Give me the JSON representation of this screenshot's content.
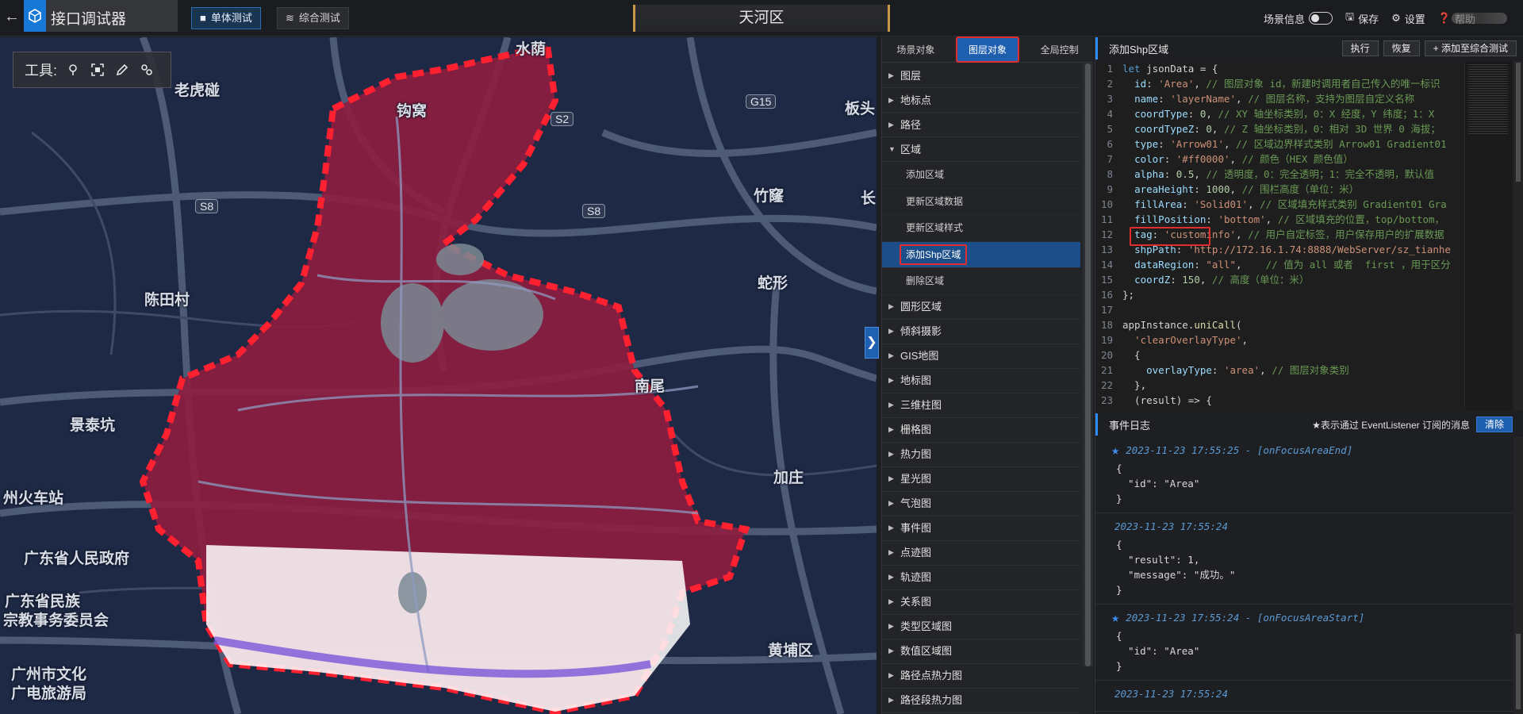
{
  "app": {
    "title": "接口调试器"
  },
  "mode_tabs": [
    {
      "label": "单体测试",
      "active": true
    },
    {
      "label": "综合测试",
      "active": false
    }
  ],
  "region_title": "天河区",
  "top_right": {
    "scene_info": "场景信息",
    "save": "保存",
    "settings": "设置",
    "help": "帮助"
  },
  "map": {
    "toolbar_label": "工具:",
    "labels": [
      {
        "text": "水荫"
      },
      {
        "text": "老虎碰"
      },
      {
        "text": "钩窝"
      },
      {
        "text": "板头"
      },
      {
        "text": "竹窿"
      },
      {
        "text": "长"
      },
      {
        "text": "陈田村"
      },
      {
        "text": "蛇形"
      },
      {
        "text": "南尾"
      },
      {
        "text": "景泰坑"
      },
      {
        "text": "加庄"
      },
      {
        "text": "州火车站"
      },
      {
        "text": "广东省人民政府"
      },
      {
        "text": "广东省民族"
      },
      {
        "text": "宗教事务委员会"
      },
      {
        "text": "广州市文化"
      },
      {
        "text": "广电旅游局"
      },
      {
        "text": "黄埔区"
      }
    ],
    "road_badges": [
      {
        "text": "G15"
      },
      {
        "text": "S2"
      },
      {
        "text": "S8"
      },
      {
        "text": "S8"
      }
    ],
    "overlay_color": "#ff0000",
    "overlay_alpha": 0.5
  },
  "mid_panel": {
    "tabs": [
      {
        "label": "场景对象",
        "active": false
      },
      {
        "label": "图层对象",
        "active": true
      },
      {
        "label": "全局控制",
        "active": false
      }
    ],
    "tree": [
      {
        "label": "图层",
        "expanded": false
      },
      {
        "label": "地标点",
        "expanded": false
      },
      {
        "label": "路径",
        "expanded": false
      },
      {
        "label": "区域",
        "expanded": true,
        "children": [
          {
            "label": "添加区域",
            "selected": false
          },
          {
            "label": "更新区域数据",
            "selected": false
          },
          {
            "label": "更新区域样式",
            "selected": false
          },
          {
            "label": "添加Shp区域",
            "selected": true
          },
          {
            "label": "删除区域",
            "selected": false
          }
        ]
      },
      {
        "label": "圆形区域",
        "expanded": false
      },
      {
        "label": "倾斜摄影",
        "expanded": false
      },
      {
        "label": "GIS地图",
        "expanded": false
      },
      {
        "label": "地标图",
        "expanded": false
      },
      {
        "label": "三维柱图",
        "expanded": false
      },
      {
        "label": "栅格图",
        "expanded": false
      },
      {
        "label": "热力图",
        "expanded": false
      },
      {
        "label": "星光图",
        "expanded": false
      },
      {
        "label": "气泡图",
        "expanded": false
      },
      {
        "label": "事件图",
        "expanded": false
      },
      {
        "label": "点迹图",
        "expanded": false
      },
      {
        "label": "轨迹图",
        "expanded": false
      },
      {
        "label": "关系图",
        "expanded": false
      },
      {
        "label": "类型区域图",
        "expanded": false
      },
      {
        "label": "数值区域图",
        "expanded": false
      },
      {
        "label": "路径点热力图",
        "expanded": false
      },
      {
        "label": "路径段热力图",
        "expanded": false
      }
    ]
  },
  "code_panel": {
    "title": "添加Shp区域",
    "buttons": {
      "run": "执行",
      "restore": "恢复",
      "add_to_combined": "添加至综合测试"
    },
    "lines": [
      [
        {
          "t": "kw",
          "v": "let "
        },
        {
          "t": "",
          "v": "jsonData = {"
        }
      ],
      [
        {
          "t": "",
          "v": "  "
        },
        {
          "t": "prop",
          "v": "id"
        },
        {
          "t": "",
          "v": ": "
        },
        {
          "t": "str",
          "v": "'Area'"
        },
        {
          "t": "",
          "v": ", "
        },
        {
          "t": "cmt",
          "v": "// 图层对象 id，新建时调用者自己传入的唯一标识"
        }
      ],
      [
        {
          "t": "",
          "v": "  "
        },
        {
          "t": "prop",
          "v": "name"
        },
        {
          "t": "",
          "v": ": "
        },
        {
          "t": "str",
          "v": "'layerName'"
        },
        {
          "t": "",
          "v": ", "
        },
        {
          "t": "cmt",
          "v": "// 图层名称，支持为图层自定义名称"
        }
      ],
      [
        {
          "t": "",
          "v": "  "
        },
        {
          "t": "prop",
          "v": "coordType"
        },
        {
          "t": "",
          "v": ": "
        },
        {
          "t": "num",
          "v": "0"
        },
        {
          "t": "",
          "v": ", "
        },
        {
          "t": "cmt",
          "v": "// XY 轴坐标类别，0：X 经度，Y 纬度；1：X"
        }
      ],
      [
        {
          "t": "",
          "v": "  "
        },
        {
          "t": "prop",
          "v": "coordTypeZ"
        },
        {
          "t": "",
          "v": ": "
        },
        {
          "t": "num",
          "v": "0"
        },
        {
          "t": "",
          "v": ", "
        },
        {
          "t": "cmt",
          "v": "// Z 轴坐标类别，0：相对 3D 世界 0 海拔；"
        }
      ],
      [
        {
          "t": "",
          "v": "  "
        },
        {
          "t": "prop",
          "v": "type"
        },
        {
          "t": "",
          "v": ": "
        },
        {
          "t": "str",
          "v": "'Arrow01'"
        },
        {
          "t": "",
          "v": ", "
        },
        {
          "t": "cmt",
          "v": "// 区域边界样式类别 Arrow01 Gradient01"
        }
      ],
      [
        {
          "t": "",
          "v": "  "
        },
        {
          "t": "prop",
          "v": "color"
        },
        {
          "t": "",
          "v": ": "
        },
        {
          "t": "str",
          "v": "'#ff0000'"
        },
        {
          "t": "",
          "v": ", "
        },
        {
          "t": "cmt",
          "v": "// 颜色（HEX 颜色值）"
        }
      ],
      [
        {
          "t": "",
          "v": "  "
        },
        {
          "t": "prop",
          "v": "alpha"
        },
        {
          "t": "",
          "v": ": "
        },
        {
          "t": "num",
          "v": "0.5"
        },
        {
          "t": "",
          "v": ", "
        },
        {
          "t": "cmt",
          "v": "// 透明度，0：完全透明；1：完全不透明，默认值"
        }
      ],
      [
        {
          "t": "",
          "v": "  "
        },
        {
          "t": "prop",
          "v": "areaHeight"
        },
        {
          "t": "",
          "v": ": "
        },
        {
          "t": "num",
          "v": "1000"
        },
        {
          "t": "",
          "v": ", "
        },
        {
          "t": "cmt",
          "v": "// 围栏高度（单位：米）"
        }
      ],
      [
        {
          "t": "",
          "v": "  "
        },
        {
          "t": "prop",
          "v": "fillArea"
        },
        {
          "t": "",
          "v": ": "
        },
        {
          "t": "str",
          "v": "'Solid01'"
        },
        {
          "t": "",
          "v": ", "
        },
        {
          "t": "cmt",
          "v": "// 区域填充样式类别 Gradient01 Gra"
        }
      ],
      [
        {
          "t": "",
          "v": "  "
        },
        {
          "t": "prop",
          "v": "fillPosition"
        },
        {
          "t": "",
          "v": ": "
        },
        {
          "t": "str",
          "v": "'bottom'"
        },
        {
          "t": "",
          "v": ", "
        },
        {
          "t": "cmt",
          "v": "// 区域填充的位置，top/bottom，"
        }
      ],
      [
        {
          "t": "",
          "v": "  "
        },
        {
          "t": "prop",
          "v": "tag"
        },
        {
          "t": "",
          "v": ": "
        },
        {
          "t": "str",
          "v": "'custominfo'"
        },
        {
          "t": "",
          "v": ", "
        },
        {
          "t": "cmt",
          "v": "// 用户自定标签，用户保存用户的扩展数据"
        }
      ],
      [
        {
          "t": "",
          "v": "  "
        },
        {
          "t": "prop",
          "v": "shpPath"
        },
        {
          "t": "",
          "v": ": "
        },
        {
          "t": "str",
          "v": "'http://172.16.1.74:8888/WebServer/sz_tianhe"
        }
      ],
      [
        {
          "t": "",
          "v": "  "
        },
        {
          "t": "prop",
          "v": "dataRegion"
        },
        {
          "t": "",
          "v": ": "
        },
        {
          "t": "str",
          "v": "\"all\""
        },
        {
          "t": "",
          "v": ",    "
        },
        {
          "t": "cmt",
          "v": "// 值为 all 或者  first ，用于区分"
        }
      ],
      [
        {
          "t": "",
          "v": "  "
        },
        {
          "t": "prop",
          "v": "coordZ"
        },
        {
          "t": "",
          "v": ": "
        },
        {
          "t": "num",
          "v": "150"
        },
        {
          "t": "",
          "v": ", "
        },
        {
          "t": "cmt",
          "v": "// 高度（单位：米）"
        }
      ],
      [
        {
          "t": "",
          "v": "};"
        }
      ],
      [
        {
          "t": "",
          "v": ""
        }
      ],
      [
        {
          "t": "",
          "v": "appInstance."
        },
        {
          "t": "fn",
          "v": "uniCall"
        },
        {
          "t": "",
          "v": "("
        }
      ],
      [
        {
          "t": "",
          "v": "  "
        },
        {
          "t": "str",
          "v": "'clearOverlayType'"
        },
        {
          "t": "",
          "v": ","
        }
      ],
      [
        {
          "t": "",
          "v": "  {"
        }
      ],
      [
        {
          "t": "",
          "v": "    "
        },
        {
          "t": "prop",
          "v": "overlayType"
        },
        {
          "t": "",
          "v": ": "
        },
        {
          "t": "str",
          "v": "'area'"
        },
        {
          "t": "",
          "v": ", "
        },
        {
          "t": "cmt",
          "v": "// 图层对象类别"
        }
      ],
      [
        {
          "t": "",
          "v": "  },"
        }
      ],
      [
        {
          "t": "",
          "v": "  (result) => {"
        }
      ]
    ]
  },
  "log_panel": {
    "title": "事件日志",
    "note": "★表示通过 EventListener 订阅的消息",
    "clear": "清除",
    "entries": [
      {
        "event": true,
        "time": "2023-11-23 17:55:25 - [onFocusAreaEnd]",
        "body": "{\n  \"id\": \"Area\"\n}"
      },
      {
        "event": false,
        "time": "2023-11-23 17:55:24",
        "body": "{\n  \"result\": 1,\n  \"message\": \"成功。\"\n}"
      },
      {
        "event": true,
        "time": "2023-11-23 17:55:24 - [onFocusAreaStart]",
        "body": "{\n  \"id\": \"Area\"\n}"
      },
      {
        "event": false,
        "time": "2023-11-23 17:55:24",
        "body": ""
      }
    ]
  }
}
